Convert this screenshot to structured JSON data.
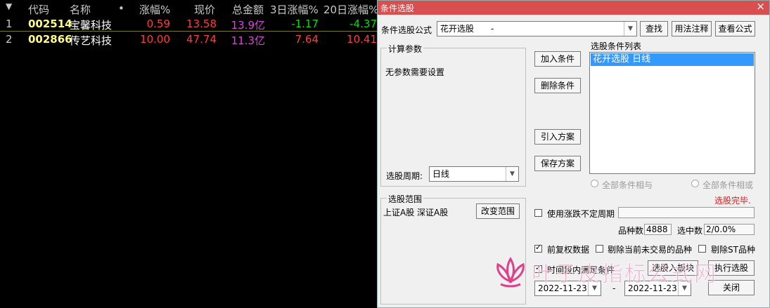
{
  "table": {
    "headers": [
      "代码",
      "名称",
      "•",
      "涨幅%",
      "现价",
      "总金额",
      "3日涨幅%",
      "20日涨幅%"
    ],
    "rows": [
      {
        "idx": "1",
        "code": "002514",
        "name": "宝馨科技",
        "chg": "0.59",
        "price": "13.58",
        "amount": "13.9亿",
        "chg3": "-1.17",
        "chg20": "-4.37",
        "cut": "58"
      },
      {
        "idx": "2",
        "code": "002866",
        "name": "传艺科技",
        "chg": "10.00",
        "price": "47.74",
        "amount": "11.3亿",
        "chg3": "7.64",
        "chg20": "10.41",
        "cut": "96"
      }
    ],
    "cut_header": "千",
    "colors": {
      "red": "#ff3c3c",
      "green": "#00e000",
      "magenta": "#e040e0",
      "code": "#ffff80",
      "name": "#ffffff",
      "idx": "#c8c8c8"
    }
  },
  "dialog": {
    "title": "条件选股",
    "close": "×",
    "formula_label": "条件选股公式",
    "formula_value": "花开选股　　-",
    "btn_find": "查找",
    "btn_usage": "用法注释",
    "btn_view": "查看公式",
    "params_group": "计算参数",
    "params_text": "无参数需要设置",
    "period_label": "选股周期:",
    "period_value": "日线",
    "btn_add": "加入条件",
    "btn_delete": "删除条件",
    "btn_import": "引入方案",
    "btn_save": "保存方案",
    "cond_list_title": "选股条件列表",
    "cond_item": "花开选股  日线",
    "radio_and": "全部条件相与",
    "radio_or": "全部条件相或",
    "status": "选股完毕.",
    "range_group": "选股范围",
    "range_text": "上证A股 深证A股",
    "btn_range": "改变范围",
    "chk_volatile": "使用涨跌不定周期",
    "count_label": "品种数",
    "count_value": "4888",
    "hit_label": "选中数",
    "hit_value": "2/0.0%",
    "chk_adjust": "前复权数据",
    "chk_notrade": "剔除当前未交易的品种",
    "chk_st": "剔除ST品种",
    "chk_period": "时间段内满足条件",
    "btn_to_block": "选股入板块",
    "btn_execute": "执行选股",
    "date_from": "2022-11-23",
    "date_sep": "-",
    "date_to": "2022-11-23",
    "btn_close": "关闭"
  },
  "watermark": {
    "text": "叶子皮指标公式网",
    "color": "#e0408a"
  }
}
